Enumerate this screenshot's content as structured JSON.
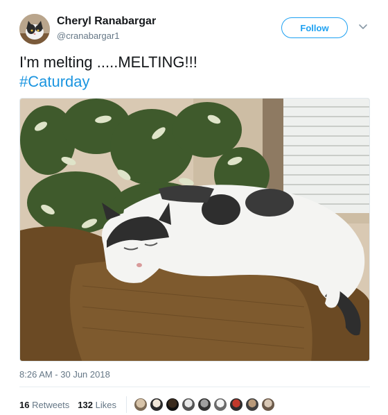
{
  "author": {
    "name": "Cheryl Ranabargar",
    "handle": "@cranabargar1"
  },
  "follow_label": "Follow",
  "tweet": {
    "text": "I'm melting .....MELTING!!!",
    "hashtag": "#Caturday"
  },
  "timestamp": "8:26 AM - 30 Jun 2018",
  "stats": {
    "retweets_count": "16",
    "retweets_label": "Retweets",
    "likes_count": "132",
    "likes_label": "Likes"
  },
  "colors": {
    "link": "#1b95e0",
    "follow_border": "#1da1f2",
    "secondary_text": "#657786"
  },
  "icons": [
    "chevron-down-icon"
  ]
}
